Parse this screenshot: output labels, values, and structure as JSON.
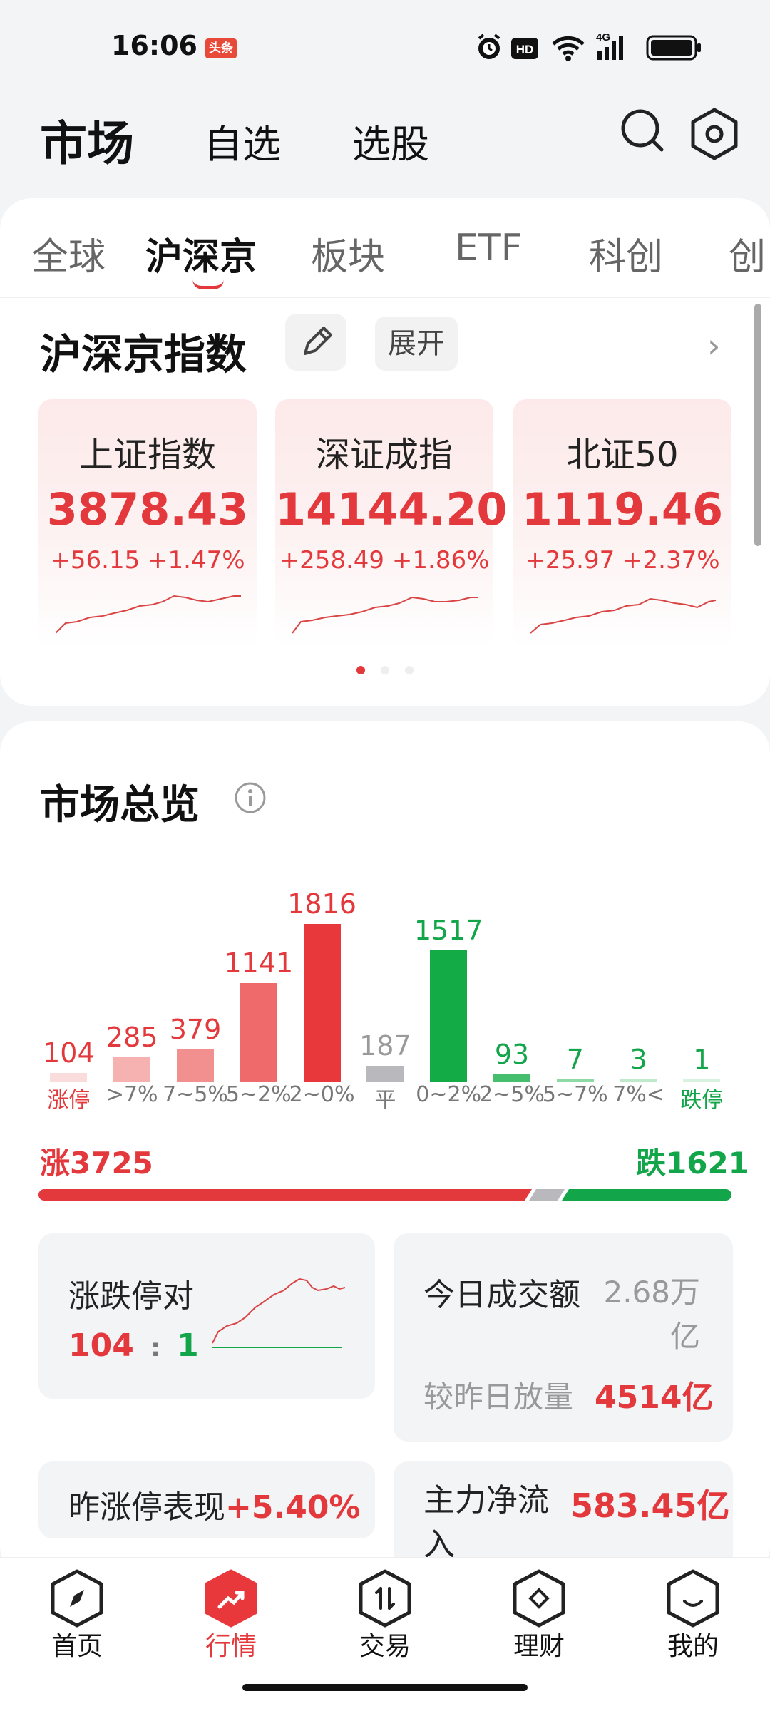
{
  "status_bar": {
    "time": "16:06",
    "toutiao_badge": "头条",
    "network": "4G"
  },
  "header": {
    "title": "市场",
    "tabs": [
      "自选",
      "选股"
    ]
  },
  "sub_tabs": {
    "items": [
      "全球",
      "沪深京",
      "板块",
      "ETF",
      "科创",
      "创"
    ],
    "active": "沪深京"
  },
  "indices_section": {
    "title": "沪深京指数",
    "expand_label": "展开",
    "cards": [
      {
        "name": "上证指数",
        "value": "3878.43",
        "change": "+56.15",
        "pct": "+1.47%"
      },
      {
        "name": "深证成指",
        "value": "14144.20",
        "change": "+258.49",
        "pct": "+1.86%"
      },
      {
        "name": "北证50",
        "value": "1119.46",
        "change": "+25.97",
        "pct": "+2.37%"
      }
    ]
  },
  "overview": {
    "title": "市场总览",
    "rise_label": "涨3725",
    "fall_label": "跌1621",
    "limit_pair": {
      "title": "涨跌停对",
      "up": "104",
      "sep": ":",
      "down": "1"
    },
    "turnover": {
      "title": "今日成交额",
      "value": "2.68万亿",
      "compare_label": "较昨日放量",
      "compare_value": "4514亿"
    },
    "yesterday_limit": {
      "title": "昨涨停表现",
      "value": "+5.40%"
    },
    "main_flow": {
      "title": "主力净流入",
      "value": "583.45亿"
    }
  },
  "chart_data": {
    "type": "bar",
    "categories": [
      "涨停",
      ">7%",
      "7~5%",
      "5~2%",
      "2~0%",
      "平",
      "0~2%",
      "2~5%",
      "5~7%",
      "7%<",
      "跌停"
    ],
    "values": [
      104,
      285,
      379,
      1141,
      1816,
      187,
      1517,
      93,
      7,
      3,
      1
    ],
    "colors": [
      "#fbdcdc",
      "#f6b1b1",
      "#f28f8f",
      "#ef6a6a",
      "#e8383b",
      "#b9b9bd",
      "#12ab45",
      "#45bf6d",
      "#8fd9a5",
      "#bfe9cb",
      "#d8f2df"
    ],
    "label_colors": [
      "#e3393c",
      "#e3393c",
      "#e3393c",
      "#e3393c",
      "#e3393c",
      "#9a9a9a",
      "#13a54a",
      "#13a54a",
      "#13a54a",
      "#13a54a",
      "#13a54a"
    ],
    "ylim": [
      0,
      1816
    ]
  },
  "bottom_nav": {
    "items": [
      {
        "label": "首页",
        "icon": "compass-icon"
      },
      {
        "label": "行情",
        "icon": "trend-icon"
      },
      {
        "label": "交易",
        "icon": "exchange-icon"
      },
      {
        "label": "理财",
        "icon": "diamond-icon"
      },
      {
        "label": "我的",
        "icon": "smile-icon"
      }
    ],
    "active": "行情"
  },
  "colors": {
    "up": "#e3393c",
    "down": "#13a54a",
    "flat": "#9a9a9a"
  }
}
